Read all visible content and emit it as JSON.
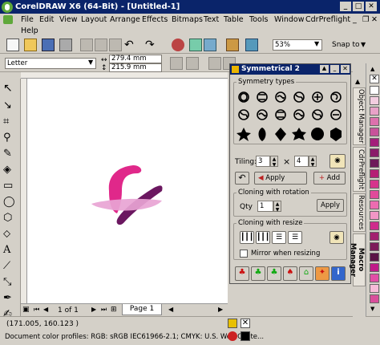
{
  "window": {
    "title": "CorelDRAW X6 (64-Bit) - [Untitled-1]"
  },
  "menu": [
    "File",
    "Edit",
    "View",
    "Layout",
    "Arrange",
    "Effects",
    "Bitmaps",
    "Text",
    "Table",
    "Tools",
    "Window",
    "CdrPreflight",
    "Help"
  ],
  "toolbar": {
    "zoom": "53%",
    "snap": "Snap to"
  },
  "property_bar": {
    "paper": "Letter",
    "width": "279.4 mm",
    "height": "215.9 mm"
  },
  "docker": {
    "title": "Symmetrical 2",
    "symmetry_types_label": "Symmetry types",
    "tiling_label": "Tiling:",
    "tiling_a": "3",
    "tiling_times": "×",
    "tiling_b": "4",
    "apply_label": "Apply",
    "add_label": "Add",
    "cloning_rotation_label": "Cloning with rotation",
    "qty_label": "Qty",
    "qty_value": "1",
    "apply2_label": "Apply",
    "cloning_resize_label": "Cloning with resize",
    "mirror_label": "Mirror when resizing"
  },
  "side_tabs": [
    "Object Manager",
    "CdrPreflight",
    "Resources",
    "Macro Manager"
  ],
  "page_nav": {
    "count": "1 of 1",
    "page_tab": "Page 1"
  },
  "status": {
    "coords": "(171.005, 160.123 )",
    "profiles": "Document color profiles: RGB: sRGB IEC61966-2.1; CMYK: U.S. Web Coate..."
  },
  "palette_colors": [
    "#ffffff",
    "#f3cde0",
    "#e8a2c8",
    "#dd71ad",
    "#c8539a",
    "#a31f7a",
    "#8a1c6a",
    "#6e1a5a",
    "#b51f75",
    "#d6338c",
    "#e04a9a",
    "#ec6cb0",
    "#f296c6",
    "#cf2c8c",
    "#a2216f",
    "#7d1b5a",
    "#5b1446",
    "#c01a88",
    "#e24ea6",
    "#f7bcd9",
    "#d94e9b"
  ]
}
